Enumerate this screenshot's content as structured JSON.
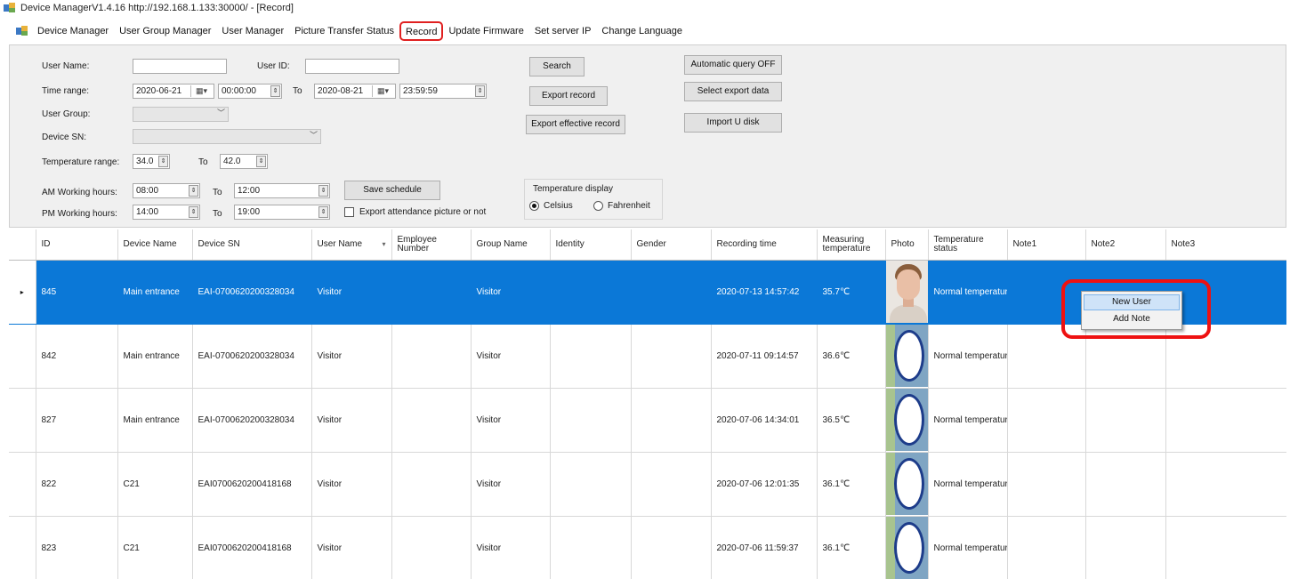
{
  "window": {
    "title": "Device ManagerV1.4.16 http://192.168.1.133:30000/ - [Record]"
  },
  "menu": [
    "Device Manager",
    "User Group Manager",
    "User Manager",
    "Picture Transfer Status",
    "Record",
    "Update Firmware",
    "Set server IP",
    "Change Language"
  ],
  "menu_highlighted": "Record",
  "form": {
    "user_name_label": "User Name:",
    "user_name_value": "",
    "user_id_label": "User ID:",
    "user_id_value": "",
    "time_range_label": "Time range:",
    "start_date": "2020-06-21",
    "start_time": "00:00:00",
    "to": "To",
    "end_date": "2020-08-21",
    "end_time": "23:59:59",
    "user_group_label": "User Group:",
    "device_sn_label": "Device SN:",
    "temp_range_label": "Temperature range:",
    "temp_min": "34.0",
    "temp_max": "42.0",
    "am_hours_label": "AM Working hours:",
    "am_start": "08:00",
    "am_end": "12:00",
    "pm_hours_label": "PM Working hours:",
    "pm_start": "14:00",
    "pm_end": "19:00",
    "save_schedule": "Save schedule",
    "export_pic_checkbox": "Export attendance picture or not",
    "search": "Search",
    "export_record": "Export record",
    "export_effective": "Export effective record",
    "auto_query": "Automatic query  OFF",
    "select_export": "Select export data",
    "import_u_disk": "Import U disk",
    "temp_display_label": "Temperature display",
    "celsius": "Celsius",
    "fahrenheit": "Fahrenheit"
  },
  "table": {
    "columns": [
      "ID",
      "Device Name",
      "Device SN",
      "User Name",
      "Employee Number",
      "Group Name",
      "Identity",
      "Gender",
      "Recording time",
      "Measuring temperature",
      "Photo",
      "Temperature status",
      "Note1",
      "Note2",
      "Note3"
    ],
    "rows": [
      {
        "id": "845",
        "device_name": "Main entrance",
        "device_sn": "EAI-0700620200328034",
        "user_name": "Visitor",
        "employee_number": "",
        "group_name": "Visitor",
        "identity": "",
        "gender": "",
        "recording_time": "2020-07-13  14:57:42",
        "temperature": "35.7℃",
        "photo": "face",
        "temp_status": "Normal temperature",
        "note1": "",
        "note2": "",
        "note3": "",
        "selected": true
      },
      {
        "id": "842",
        "device_name": "Main entrance",
        "device_sn": "EAI-0700620200328034",
        "user_name": "Visitor",
        "employee_number": "",
        "group_name": "Visitor",
        "identity": "",
        "gender": "",
        "recording_time": "2020-07-11  09:14:57",
        "temperature": "36.6℃",
        "photo": "blurred",
        "temp_status": "Normal temperature",
        "note1": "",
        "note2": "",
        "note3": ""
      },
      {
        "id": "827",
        "device_name": "Main entrance",
        "device_sn": "EAI-0700620200328034",
        "user_name": "Visitor",
        "employee_number": "",
        "group_name": "Visitor",
        "identity": "",
        "gender": "",
        "recording_time": "2020-07-06  14:34:01",
        "temperature": "36.5℃",
        "photo": "blurred",
        "temp_status": "Normal temperature",
        "note1": "",
        "note2": "",
        "note3": ""
      },
      {
        "id": "822",
        "device_name": "C21",
        "device_sn": "EAI0700620200418168",
        "user_name": "Visitor",
        "employee_number": "",
        "group_name": "Visitor",
        "identity": "",
        "gender": "",
        "recording_time": "2020-07-06  12:01:35",
        "temperature": "36.1℃",
        "photo": "blurred",
        "temp_status": "Normal temperature",
        "note1": "",
        "note2": "",
        "note3": ""
      },
      {
        "id": "823",
        "device_name": "C21",
        "device_sn": "EAI0700620200418168",
        "user_name": "Visitor",
        "employee_number": "",
        "group_name": "Visitor",
        "identity": "",
        "gender": "",
        "recording_time": "2020-07-06  11:59:37",
        "temperature": "36.1℃",
        "photo": "blurred",
        "temp_status": "Normal temperature",
        "note1": "",
        "note2": "",
        "note3": ""
      }
    ]
  },
  "context_menu": [
    "New User",
    "Add Note"
  ],
  "colors": {
    "selection": "#0b78d7",
    "highlight_box": "#ee1111",
    "menu_hover": "#cfe3f8"
  }
}
